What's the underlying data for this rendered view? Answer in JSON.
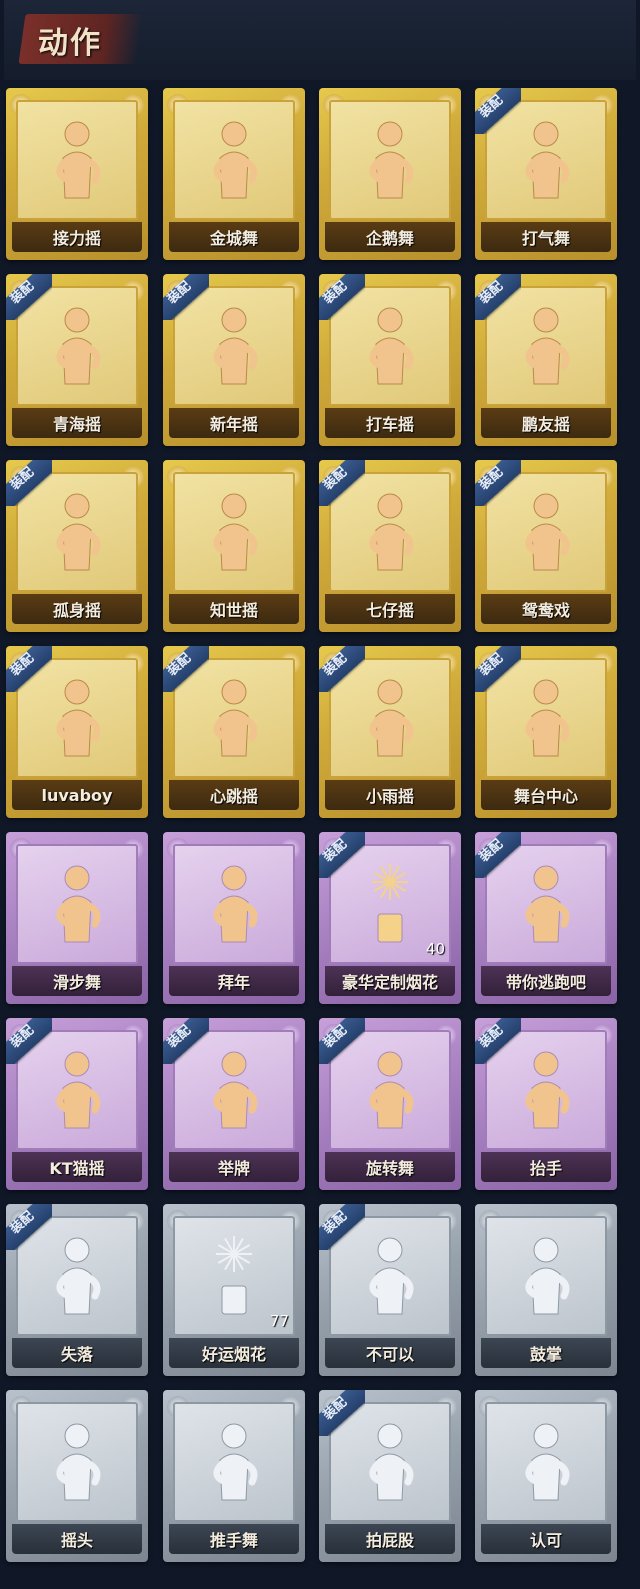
{
  "header": {
    "title": "动作"
  },
  "equipped_badge_text": "装配",
  "colors": {
    "gold": "#d0ab3a",
    "purple": "#a982c2",
    "grey": "#98a2ad",
    "badge": "#2f4a78"
  },
  "items": [
    {
      "label": "接力摇",
      "tier": "gold",
      "equipped": false,
      "icon": "dancer-figure-icon"
    },
    {
      "label": "金城舞",
      "tier": "gold",
      "equipped": false,
      "icon": "dancer-figure-icon"
    },
    {
      "label": "企鹅舞",
      "tier": "gold",
      "equipped": false,
      "icon": "dancer-figure-icon"
    },
    {
      "label": "打气舞",
      "tier": "gold",
      "equipped": true,
      "icon": "dancer-figure-icon"
    },
    {
      "label": "青海摇",
      "tier": "gold",
      "equipped": true,
      "icon": "dancer-figure-icon"
    },
    {
      "label": "新年摇",
      "tier": "gold",
      "equipped": true,
      "icon": "dancer-figure-icon"
    },
    {
      "label": "打车摇",
      "tier": "gold",
      "equipped": true,
      "icon": "dancer-figure-icon"
    },
    {
      "label": "鹏友摇",
      "tier": "gold",
      "equipped": true,
      "icon": "dancer-figure-icon"
    },
    {
      "label": "孤身摇",
      "tier": "gold",
      "equipped": true,
      "icon": "dancer-figure-icon"
    },
    {
      "label": "知世摇",
      "tier": "gold",
      "equipped": false,
      "icon": "dancer-figure-icon"
    },
    {
      "label": "七仔摇",
      "tier": "gold",
      "equipped": true,
      "icon": "dancer-figure-icon"
    },
    {
      "label": "鸳鸯戏",
      "tier": "gold",
      "equipped": true,
      "icon": "dancer-figure-icon"
    },
    {
      "label": "luvaboy",
      "tier": "gold",
      "equipped": true,
      "icon": "dancer-figure-icon"
    },
    {
      "label": "心跳摇",
      "tier": "gold",
      "equipped": true,
      "icon": "dancer-figure-icon"
    },
    {
      "label": "小雨摇",
      "tier": "gold",
      "equipped": true,
      "icon": "dancer-figure-icon"
    },
    {
      "label": "舞台中心",
      "tier": "gold",
      "equipped": true,
      "icon": "dancer-figure-icon"
    },
    {
      "label": "滑步舞",
      "tier": "purple",
      "equipped": false,
      "icon": "dancer-figure-icon"
    },
    {
      "label": "拜年",
      "tier": "purple",
      "equipped": false,
      "icon": "greeting-figure-icon"
    },
    {
      "label": "豪华定制烟花",
      "tier": "purple",
      "equipped": true,
      "icon": "fireworks-icon",
      "count": "40"
    },
    {
      "label": "带你逃跑吧",
      "tier": "purple",
      "equipped": true,
      "icon": "dancer-figure-icon"
    },
    {
      "label": "KT猫摇",
      "tier": "purple",
      "equipped": true,
      "icon": "dancer-figure-icon"
    },
    {
      "label": "举牌",
      "tier": "purple",
      "equipped": true,
      "icon": "sign-holding-figure-icon"
    },
    {
      "label": "旋转舞",
      "tier": "purple",
      "equipped": true,
      "icon": "spinning-figure-icon"
    },
    {
      "label": "抬手",
      "tier": "purple",
      "equipped": true,
      "icon": "raised-hand-figure-icon"
    },
    {
      "label": "失落",
      "tier": "grey",
      "equipped": true,
      "icon": "crawling-figure-icon"
    },
    {
      "label": "好运烟花",
      "tier": "grey",
      "equipped": false,
      "icon": "firecracker-icon",
      "count": "77"
    },
    {
      "label": "不可以",
      "tier": "grey",
      "equipped": true,
      "icon": "wagging-finger-icon"
    },
    {
      "label": "鼓掌",
      "tier": "grey",
      "equipped": false,
      "icon": "clapping-hands-icon"
    },
    {
      "label": "摇头",
      "tier": "grey",
      "equipped": false,
      "icon": "headshake-figure-icon"
    },
    {
      "label": "推手舞",
      "tier": "grey",
      "equipped": false,
      "icon": "pushing-figure-icon"
    },
    {
      "label": "拍屁股",
      "tier": "grey",
      "equipped": true,
      "icon": "butt-slap-figure-icon"
    },
    {
      "label": "认可",
      "tier": "grey",
      "equipped": false,
      "icon": "thumbs-up-icon"
    }
  ]
}
